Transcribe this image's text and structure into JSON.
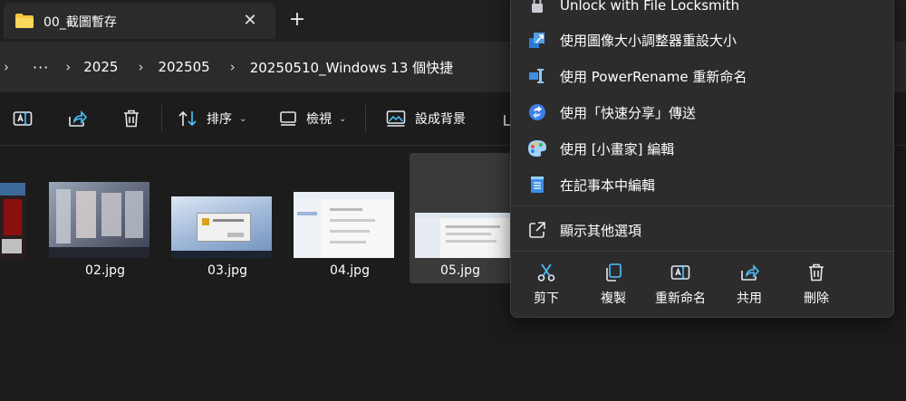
{
  "tab": {
    "title": "00_截圖暫存",
    "close_label": "✕",
    "new_label": "+"
  },
  "breadcrumb": {
    "overflow": "···",
    "items": [
      "2025",
      "202505",
      "20250510_Windows 13 個快捷"
    ]
  },
  "toolbar": {
    "sort_label": "排序",
    "view_label": "檢視",
    "set_bg_label": "設成背景"
  },
  "files": [
    {
      "name": "02.jpg"
    },
    {
      "name": "03.jpg"
    },
    {
      "name": "04.jpg"
    },
    {
      "name": "05.jpg"
    }
  ],
  "context_menu": {
    "items": [
      {
        "label": "Unlock with File Locksmith",
        "icon": "lock-icon"
      },
      {
        "label": "使用圖像大小調整器重設大小",
        "icon": "image-resizer-icon"
      },
      {
        "label": "使用 PowerRename 重新命名",
        "icon": "power-rename-icon"
      },
      {
        "label": "使用「快速分享」傳送",
        "icon": "quick-share-icon"
      },
      {
        "label": "使用 [小畫家] 編輯",
        "icon": "paint-icon"
      },
      {
        "label": "在記事本中編輯",
        "icon": "notepad-icon"
      }
    ],
    "more_options": "顯示其他選項",
    "quick_actions": [
      {
        "label": "剪下",
        "icon": "scissors-icon"
      },
      {
        "label": "複製",
        "icon": "copy-icon"
      },
      {
        "label": "重新命名",
        "icon": "rename-icon"
      },
      {
        "label": "共用",
        "icon": "share-icon"
      },
      {
        "label": "刪除",
        "icon": "trash-icon"
      }
    ]
  },
  "colors": {
    "accent": "#4cc2ff",
    "folder": "#f4c542",
    "selection": "#3a3a3a"
  }
}
